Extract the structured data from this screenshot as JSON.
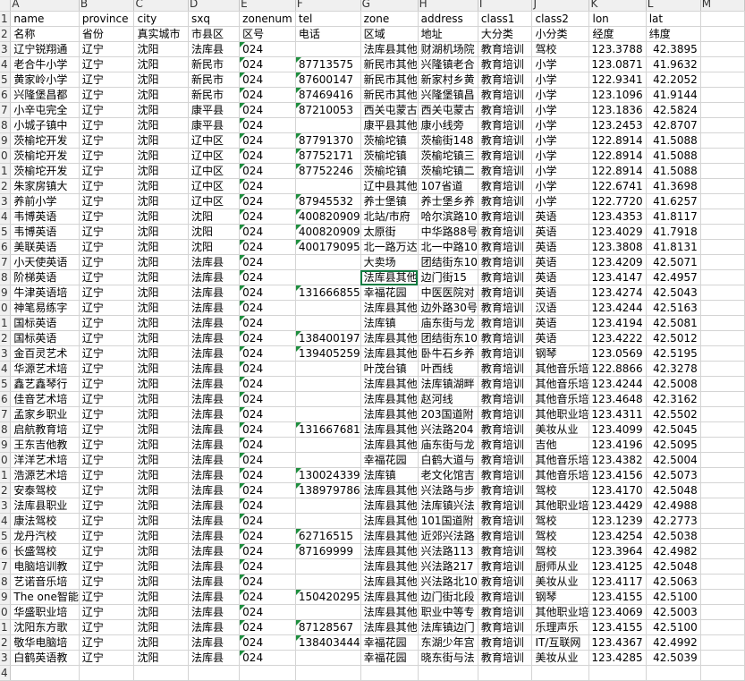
{
  "column_letters": [
    "",
    "A",
    "B",
    "C",
    "D",
    "E",
    "F",
    "G",
    "H",
    "I",
    "J",
    "K",
    "L",
    "M"
  ],
  "row_numbers": [
    "1",
    "2",
    "3",
    "4",
    "5",
    "6",
    "7",
    "8",
    "9",
    "0",
    "1",
    "2",
    "3",
    "4",
    "5",
    "6",
    "7",
    "8",
    "9",
    "0",
    "1",
    "2",
    "3",
    "4",
    "5",
    "6",
    "7",
    "8",
    "9",
    "0",
    "1",
    "2",
    "3",
    "4",
    "5",
    "6",
    "7",
    "8",
    "9",
    "0",
    "1",
    "2",
    "3",
    "4"
  ],
  "rows": [
    [
      "name",
      "province",
      "city",
      "sxq",
      "zonenum",
      "tel",
      "zone",
      "address",
      "class1",
      "class2",
      "lon",
      "lat"
    ],
    [
      "名称",
      "省份",
      "真实城市",
      "市县区",
      "区号",
      "电话",
      "区域",
      "地址",
      "大分类",
      "小分类",
      "经度",
      "纬度"
    ],
    [
      "辽宁锐翔通",
      "辽宁",
      "沈阳",
      "法库县",
      "024",
      "",
      "法库县其他",
      "财湖机场院",
      "教育培训",
      "驾校",
      "123.3788",
      "42.3895"
    ],
    [
      "老合牛小学",
      "辽宁",
      "沈阳",
      "新民市",
      "024",
      "87713575",
      "新民市其他",
      "兴隆镇老合",
      "教育培训",
      "小学",
      "123.0871",
      "41.9632"
    ],
    [
      "黄家岭小学",
      "辽宁",
      "沈阳",
      "新民市",
      "024",
      "87600147",
      "新民市其他",
      "新家村乡黄",
      "教育培训",
      "小学",
      "122.9341",
      "42.2052"
    ],
    [
      "兴隆堡昌都",
      "辽宁",
      "沈阳",
      "新民市",
      "024",
      "87469416",
      "新民市其他",
      "兴隆堡镇昌",
      "教育培训",
      "小学",
      "123.1096",
      "41.9144"
    ],
    [
      "小辛屯完全",
      "辽宁",
      "沈阳",
      "康平县",
      "024",
      "87210053",
      "西关屯蒙古",
      "西关屯蒙古",
      "教育培训",
      "小学",
      "123.1836",
      "42.5824"
    ],
    [
      "小城子镇中",
      "辽宁",
      "沈阳",
      "康平县",
      "024",
      "",
      "康平县其他",
      "康小线旁",
      "教育培训",
      "小学",
      "123.2453",
      "42.8707"
    ],
    [
      "茨榆坨开发",
      "辽宁",
      "沈阳",
      "辽中区",
      "024",
      "87791370",
      "茨榆坨镇",
      "茨榆街148",
      "教育培训",
      "小学",
      "122.8914",
      "41.5088"
    ],
    [
      "茨榆坨开发",
      "辽宁",
      "沈阳",
      "辽中区",
      "024",
      "87752171",
      "茨榆坨镇",
      "茨榆坨镇三",
      "教育培训",
      "小学",
      "122.8914",
      "41.5088"
    ],
    [
      "茨榆坨开发",
      "辽宁",
      "沈阳",
      "辽中区",
      "024",
      "87752246",
      "茨榆坨镇",
      "茨榆坨镇二",
      "教育培训",
      "小学",
      "122.8914",
      "41.5088"
    ],
    [
      "朱家房镇大",
      "辽宁",
      "沈阳",
      "辽中区",
      "024",
      "",
      "辽中县其他",
      "107省道",
      "教育培训",
      "小学",
      "122.6741",
      "41.3698"
    ],
    [
      "养前小学",
      "辽宁",
      "沈阳",
      "辽中区",
      "024",
      "87945532",
      "养士堡镇",
      "养士堡乡养",
      "教育培训",
      "小学",
      "122.7720",
      "41.6257"
    ],
    [
      "韦博英语",
      "辽宁",
      "沈阳",
      "沈阳",
      "024",
      "400820909",
      "北站/市府",
      "哈尔滨路10",
      "教育培训",
      "英语",
      "123.4353",
      "41.8117"
    ],
    [
      "韦博英语",
      "辽宁",
      "沈阳",
      "沈阳",
      "024",
      "400820909",
      "太原街",
      "中华路88号",
      "教育培训",
      "英语",
      "123.4029",
      "41.7918"
    ],
    [
      "美联英语",
      "辽宁",
      "沈阳",
      "沈阳",
      "024",
      "400179095",
      "北一路万达",
      "北一中路10",
      "教育培训",
      "英语",
      "123.3808",
      "41.8131"
    ],
    [
      "小天使英语",
      "辽宁",
      "沈阳",
      "法库县",
      "024",
      "",
      "大卖场",
      "团结街东10",
      "教育培训",
      "英语",
      "123.4209",
      "42.5071"
    ],
    [
      "阶梯英语",
      "辽宁",
      "沈阳",
      "法库县",
      "024",
      "",
      "法库县其他",
      "边门街15",
      "教育培训",
      "英语",
      "123.4147",
      "42.4957"
    ],
    [
      "牛津英语培",
      "辽宁",
      "沈阳",
      "法库县",
      "024",
      "131666855",
      "幸福花园",
      "中医医院对",
      "教育培训",
      "英语",
      "123.4274",
      "42.5043"
    ],
    [
      "神笔易练字",
      "辽宁",
      "沈阳",
      "法库县",
      "024",
      "",
      "法库县其他",
      "边外路30号",
      "教育培训",
      "汉语",
      "123.4244",
      "42.5163"
    ],
    [
      "国标英语",
      "辽宁",
      "沈阳",
      "法库县",
      "024",
      "",
      "法库镇",
      "庙东街与龙",
      "教育培训",
      "英语",
      "123.4194",
      "42.5081"
    ],
    [
      "国标英语",
      "辽宁",
      "沈阳",
      "法库县",
      "024",
      "138400197",
      "法库县其他",
      "团结街东10",
      "教育培训",
      "英语",
      "123.4222",
      "42.5012"
    ],
    [
      "金百灵艺术",
      "辽宁",
      "沈阳",
      "法库县",
      "024",
      "139405259",
      "法库县其他",
      "卧牛石乡养",
      "教育培训",
      "钢琴",
      "123.0569",
      "42.5195"
    ],
    [
      "华源艺术培",
      "辽宁",
      "沈阳",
      "法库县",
      "024",
      "",
      "叶茂台镇",
      "叶西线",
      "教育培训",
      "其他音乐培",
      "122.8866",
      "42.3278"
    ],
    [
      "鑫艺鑫琴行",
      "辽宁",
      "沈阳",
      "法库县",
      "024",
      "",
      "法库县其他",
      "法库镇湖畔",
      "教育培训",
      "其他音乐培",
      "123.4244",
      "42.5008"
    ],
    [
      "佳音艺术培",
      "辽宁",
      "沈阳",
      "法库县",
      "024",
      "",
      "法库县其他",
      "赵河线",
      "教育培训",
      "其他音乐培",
      "123.4648",
      "42.3162"
    ],
    [
      "孟家乡职业",
      "辽宁",
      "沈阳",
      "法库县",
      "024",
      "",
      "法库县其他",
      "203国道附",
      "教育培训",
      "其他职业培",
      "123.4311",
      "42.5502"
    ],
    [
      "启航教育培",
      "辽宁",
      "沈阳",
      "法库县",
      "024",
      "131667681",
      "法库县其他",
      "兴法路204",
      "教育培训",
      "美妆从业",
      "123.4099",
      "42.5045"
    ],
    [
      "王东吉他教",
      "辽宁",
      "沈阳",
      "法库县",
      "024",
      "",
      "法库县其他",
      "庙东街与龙",
      "教育培训",
      "吉他",
      "123.4196",
      "42.5095"
    ],
    [
      "洋洋艺术培",
      "辽宁",
      "沈阳",
      "法库县",
      "024",
      "",
      "幸福花园",
      "白鹤大道与",
      "教育培训",
      "其他音乐培",
      "123.4382",
      "42.5004"
    ],
    [
      "浩源艺术培",
      "辽宁",
      "沈阳",
      "法库县",
      "024",
      "130024339",
      "法库镇",
      "老文化馆吉",
      "教育培训",
      "其他音乐培",
      "123.4156",
      "42.5073"
    ],
    [
      "安泰驾校",
      "辽宁",
      "沈阳",
      "法库县",
      "024",
      "138979786",
      "法库县其他",
      "兴法路与步",
      "教育培训",
      "驾校",
      "123.4170",
      "42.5048"
    ],
    [
      "法库县职业",
      "辽宁",
      "沈阳",
      "法库县",
      "024",
      "",
      "法库县其他",
      "法库镇兴法",
      "教育培训",
      "其他职业培",
      "123.4429",
      "42.4988"
    ],
    [
      "康法驾校",
      "辽宁",
      "沈阳",
      "法库县",
      "024",
      "",
      "法库县其他",
      "101国道附",
      "教育培训",
      "驾校",
      "123.1239",
      "42.2773"
    ],
    [
      "龙丹汽校",
      "辽宁",
      "沈阳",
      "法库县",
      "024",
      "62716515",
      "法库县其他",
      "近郊兴法路",
      "教育培训",
      "驾校",
      "123.4254",
      "42.5038"
    ],
    [
      "长盛驾校",
      "辽宁",
      "沈阳",
      "法库县",
      "024",
      "87169999",
      "法库县其他",
      "兴法路113",
      "教育培训",
      "驾校",
      "123.3964",
      "42.4982"
    ],
    [
      "电脑培训教",
      "辽宁",
      "沈阳",
      "法库县",
      "024",
      "",
      "法库县其他",
      "兴法路217",
      "教育培训",
      "厨师从业",
      "123.4125",
      "42.5048"
    ],
    [
      "艺诺音乐培",
      "辽宁",
      "沈阳",
      "法库县",
      "024",
      "",
      "法库县其他",
      "兴法路北10",
      "教育培训",
      "美妆从业",
      "123.4117",
      "42.5063"
    ],
    [
      "The one智能",
      "辽宁",
      "沈阳",
      "法库县",
      "024",
      "150420295",
      "法库县其他",
      "边门街北段",
      "教育培训",
      "钢琴",
      "123.4155",
      "42.5100"
    ],
    [
      "华盛职业培",
      "辽宁",
      "沈阳",
      "法库县",
      "024",
      "",
      "法库县其他",
      "职业中等专",
      "教育培训",
      "其他职业培",
      "123.4069",
      "42.5003"
    ],
    [
      "沈阳东方歌",
      "辽宁",
      "沈阳",
      "法库县",
      "024",
      "87128567",
      "法库县其他",
      "法库镇边门",
      "教育培训",
      "乐理声乐",
      "123.4155",
      "42.5100"
    ],
    [
      "敬华电脑培",
      "辽宁",
      "沈阳",
      "法库县",
      "024",
      "138403444",
      "幸福花园",
      "东湖少年宫",
      "教育培训",
      "IT/互联网",
      "123.4367",
      "42.4992"
    ],
    [
      "白鹤英语教",
      "辽宁",
      "沈阳",
      "法库县",
      "024",
      "",
      "幸福花园",
      "晓东街与法",
      "教育培训",
      "美妆从业",
      "123.4285",
      "42.5039"
    ],
    [
      "",
      "",
      "",
      "",
      "",
      "",
      "",
      "",
      "",
      "",
      "",
      ""
    ]
  ]
}
